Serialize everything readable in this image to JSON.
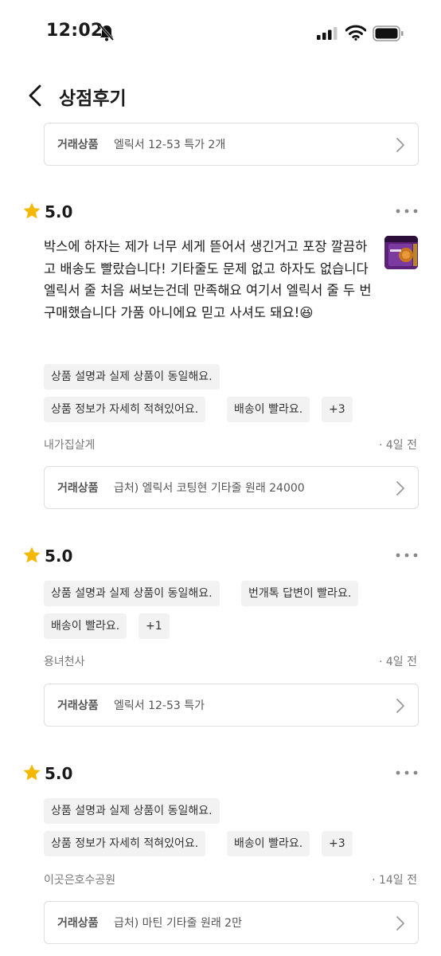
{
  "status_bar": {
    "time": "12:02"
  },
  "header": {
    "title": "상점후기"
  },
  "top_product": {
    "label": "거래상품",
    "name": "엘릭서 12-53 특가 2개"
  },
  "reviews": [
    {
      "rating": "5.0",
      "text": "박스에 하자는 제가 너무 세게 뜯어서 생긴거고 포장 깔끔하고 배송도 빨랐습니다! 기타줄도 문제 없고 하자도 없습니다 엘릭서 줄 처음 써보는건데 만족해요 여기서 엘릭서 줄 두 번 구매했습니다 가품 아니에요 믿고 사셔도 돼요!😆",
      "tags": [
        "상품 설명과 실제 상품이 동일해요.",
        "상품 정보가 자세히 적혀있어요.",
        "배송이 빨라요.",
        "+3"
      ],
      "reviewer": "내가집살게",
      "time": "· 4일 전",
      "product_label": "거래상품",
      "product_name": "급처) 엘릭서 코팅현 기타줄 원래 24000"
    },
    {
      "rating": "5.0",
      "tags": [
        "상품 설명과 실제 상품이 동일해요.",
        "번개톡 답변이 빨라요.",
        "배송이 빨라요.",
        "+1"
      ],
      "reviewer": "용녀천사",
      "time": "· 4일 전",
      "product_label": "거래상품",
      "product_name": "엘릭서 12-53 특가"
    },
    {
      "rating": "5.0",
      "tags": [
        "상품 설명과 실제 상품이 동일해요.",
        "상품 정보가 자세히 적혀있어요.",
        "배송이 빨라요.",
        "+3"
      ],
      "reviewer": "이곳은호수공원",
      "time": "· 14일 전",
      "product_label": "거래상품",
      "product_name": "급처) 마틴 기타줄 원래 2만"
    }
  ],
  "icons": {
    "star": "star-icon",
    "more": "more-horizontal-icon",
    "chevron": "chevron-right-icon",
    "back": "chevron-left-icon"
  },
  "colors": {
    "star": "#f5b800",
    "tag_bg": "#f2f2f2",
    "border": "#dedede",
    "muted_text": "#777777"
  }
}
